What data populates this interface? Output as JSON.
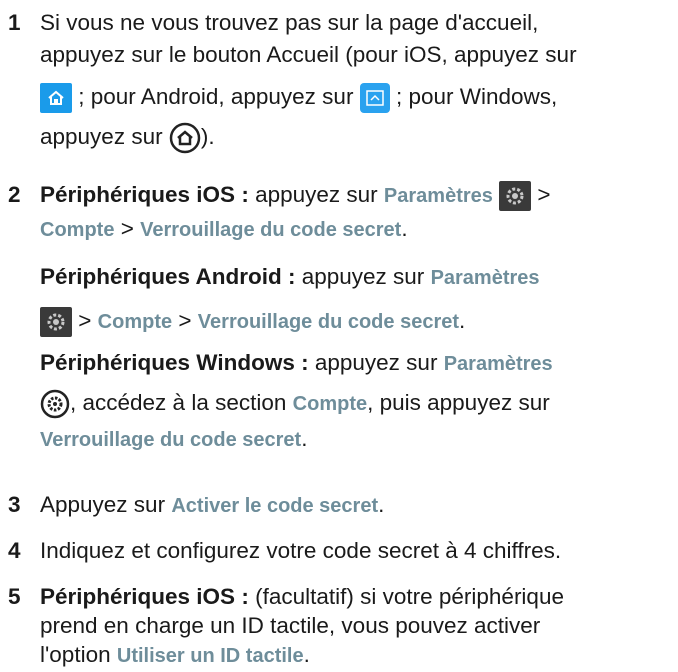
{
  "steps": [
    {
      "num": "1",
      "l1": "Si vous ne vous trouvez pas sur la page d'accueil,",
      "l2": "appuyez sur le bouton Accueil (pour iOS, appuyez sur",
      "l3a": "; pour Android, appuyez sur",
      "l3b": "; pour Windows,",
      "l4a": "appuyez sur",
      "l4b": ")."
    },
    {
      "num": "2",
      "ios_label": "Périphériques iOS :",
      "ios_t1": "appuyez sur",
      "settings": "Paramètres",
      "gt": ">",
      "account": "Compte",
      "lock": "Verrouillage du code secret",
      "dot": ".",
      "android_label": "Périphériques Android :",
      "android_t1": "appuyez sur",
      "windows_label": "Périphériques Windows :",
      "windows_t1": "appuyez sur",
      "win_t2": ", accédez à la section",
      "win_t3": ", puis appuyez sur"
    },
    {
      "num": "3",
      "t1": "Appuyez sur",
      "activate": "Activer le code secret",
      "dot": "."
    },
    {
      "num": "4",
      "t1": "Indiquez et configurez votre code secret à 4 chiffres."
    },
    {
      "num": "5",
      "ios_label": "Périphériques iOS :",
      "l1": "(facultatif) si votre périphérique",
      "l2": "prend en charge un ID tactile, vous pouvez activer",
      "l3a": "l'option",
      "touchid": "Utiliser un ID tactile",
      "dot": "."
    }
  ],
  "icons": {
    "ios_home": "home-icon",
    "android_home": "android-home-icon",
    "windows_home": "windows-home-icon",
    "settings_gear": "gear-icon",
    "windows_settings": "windows-gear-icon"
  },
  "colors": {
    "ui_text": "#6e8d9a",
    "ios_blue": "#1a9bea",
    "text": "#1a1a1a"
  }
}
